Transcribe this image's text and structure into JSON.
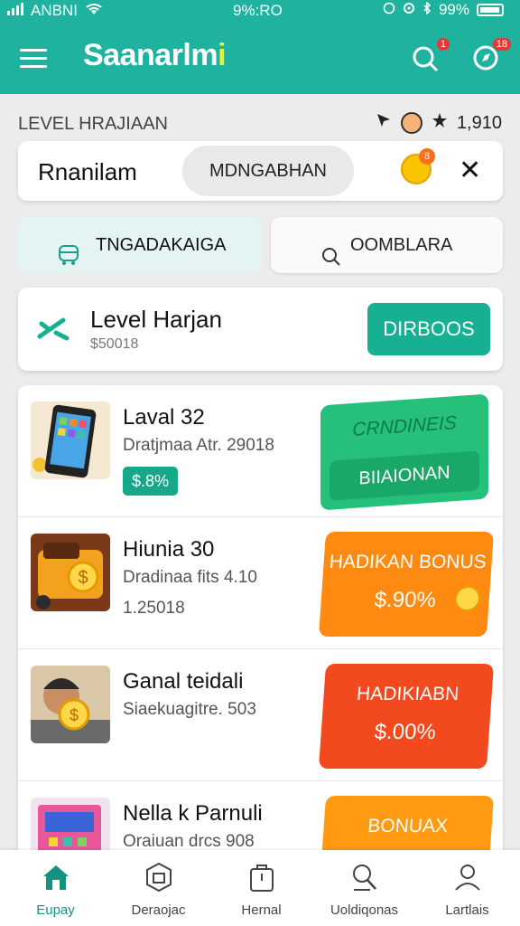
{
  "status": {
    "carrier": "ANBNI",
    "center": "9%:RO",
    "battery": "99%"
  },
  "appbar": {
    "title_main": "Saanarlm",
    "title_dot": "i",
    "badge_left": "1",
    "badge_right": "18"
  },
  "level_header": {
    "title": "LEVEL HRAJIAAN",
    "count": "1,910"
  },
  "search": {
    "label": "Rnanilam",
    "pill": "MDNGABHAN",
    "coin_badge": "8"
  },
  "filters": {
    "a_label": "TNGADAKAIGA",
    "b_label": "OOMBLARA"
  },
  "level_card": {
    "title": "Level Harjan",
    "subtitle": "$50018",
    "button": "DIRBOOS"
  },
  "offers": [
    {
      "title": "Laval 32",
      "subtitle": "Dratjmaa Atr. 29018",
      "tag": "$.8%",
      "promo_line1": "CRNDINEIS",
      "promo_line2": "BIIAIONAN",
      "promo_color": "#25c07a"
    },
    {
      "title": "Hiunia 30",
      "subtitle": "Dradinaa fits 4.10",
      "subtitle2": "1.25018",
      "promo_line1": "HADIKAN BONUS",
      "promo_line2": "$.90%",
      "promo_color": "#ff8a12"
    },
    {
      "title": "Ganal teidali",
      "subtitle": "Siaekuagitre. 503",
      "promo_line1": "HADIKIABN",
      "promo_line2": "$.00%",
      "promo_color": "#f2491f"
    },
    {
      "title": "Nella k Parnuli",
      "subtitle": "Oraiuan drcs 908",
      "promo_line1": "BONUAX",
      "promo_line2": "",
      "promo_color": "#ff9a12"
    }
  ],
  "bottom_nav": [
    {
      "label": "Eupay",
      "icon": "home-icon"
    },
    {
      "label": "Deraojac",
      "icon": "cube-icon"
    },
    {
      "label": "Hernal",
      "icon": "bag-icon"
    },
    {
      "label": "Uoldiqonas",
      "icon": "search-icon"
    },
    {
      "label": "Lartlais",
      "icon": "person-icon"
    }
  ]
}
